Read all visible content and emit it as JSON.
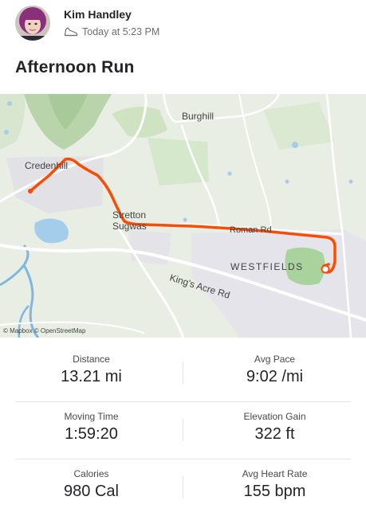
{
  "athlete": {
    "name": "Kim Handley",
    "avatar_icon": "avatar-photo"
  },
  "activity": {
    "type_icon": "running-shoe-icon",
    "time": "Today at 5:23 PM",
    "title": "Afternoon Run"
  },
  "map": {
    "route_color": "#fc4c02",
    "labels": {
      "burghill": "Burghill",
      "credenhill": "Credenhill",
      "stretton": "Stretton",
      "sugwas": "Sugwas",
      "roman_rd": "Roman Rd",
      "westfields": "WESTFIELDS",
      "kings_acre_rd": "King's Acre Rd"
    },
    "attribution": "© Mapbox © OpenStreetMap"
  },
  "stats": [
    {
      "label": "Distance",
      "value": "13.21 mi"
    },
    {
      "label": "Avg Pace",
      "value": "9:02 /mi"
    },
    {
      "label": "Moving Time",
      "value": "1:59:20"
    },
    {
      "label": "Elevation Gain",
      "value": "322 ft"
    },
    {
      "label": "Calories",
      "value": "980 Cal"
    },
    {
      "label": "Avg Heart Rate",
      "value": "155 bpm"
    }
  ]
}
